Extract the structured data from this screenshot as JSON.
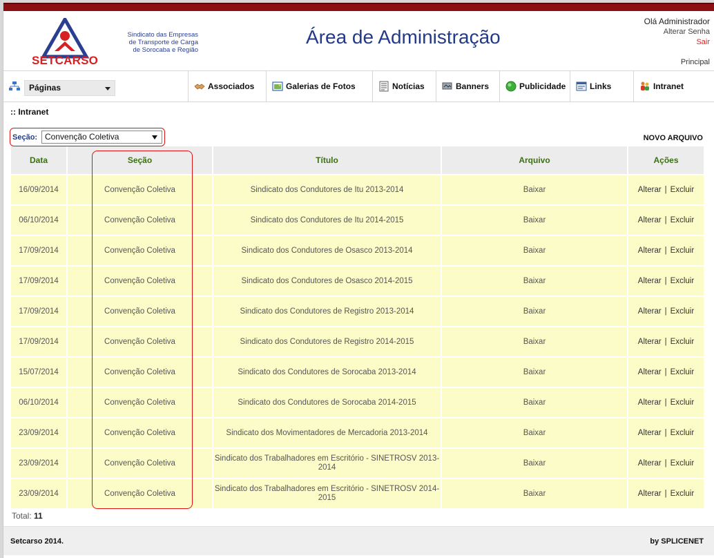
{
  "header": {
    "logo_text_lines": [
      "Sindicato das Empresas",
      "de Transporte de Carga",
      "de Sorocaba e Região"
    ],
    "logo_brand": "SETCARSO",
    "page_title": "Área de Administração",
    "greeting": "Olá Administrador",
    "change_password": "Alterar Senha",
    "logout": "Sair",
    "principal": "Principal"
  },
  "nav": {
    "pages_label": "Páginas",
    "items": [
      {
        "label": "Associados",
        "icon": "handshake-icon"
      },
      {
        "label": "Galerias de Fotos",
        "icon": "photo-gallery-icon"
      },
      {
        "label": "Notícias",
        "icon": "news-icon"
      },
      {
        "label": "Banners",
        "icon": "banner-icon"
      },
      {
        "label": "Publicidade",
        "icon": "green-circle-icon"
      },
      {
        "label": "Links",
        "icon": "links-icon"
      },
      {
        "label": "Intranet",
        "icon": "users-icon"
      }
    ]
  },
  "breadcrumb": ":: Intranet",
  "filter": {
    "label": "Seção:",
    "value": "Convenção Coletiva"
  },
  "new_file": "NOVO ARQUIVO",
  "table": {
    "headers": [
      "Data",
      "Seção",
      "Título",
      "Arquivo",
      "Ações"
    ],
    "rows": [
      {
        "date": "16/09/2014",
        "section": "Convenção Coletiva",
        "title": "Sindicato dos Condutores de Itu 2013-2014",
        "file": "Baixar"
      },
      {
        "date": "06/10/2014",
        "section": "Convenção Coletiva",
        "title": "Sindicato dos Condutores de Itu 2014-2015",
        "file": "Baixar"
      },
      {
        "date": "17/09/2014",
        "section": "Convenção Coletiva",
        "title": "Sindicato dos Condutores de Osasco 2013-2014",
        "file": "Baixar"
      },
      {
        "date": "17/09/2014",
        "section": "Convenção Coletiva",
        "title": "Sindicato dos Condutores de Osasco 2014-2015",
        "file": "Baixar"
      },
      {
        "date": "17/09/2014",
        "section": "Convenção Coletiva",
        "title": "Sindicato dos Condutores de Registro 2013-2014",
        "file": "Baixar"
      },
      {
        "date": "17/09/2014",
        "section": "Convenção Coletiva",
        "title": "Sindicato dos Condutores de Registro 2014-2015",
        "file": "Baixar"
      },
      {
        "date": "15/07/2014",
        "section": "Convenção Coletiva",
        "title": "Sindicato dos Condutores de Sorocaba 2013-2014",
        "file": "Baixar"
      },
      {
        "date": "06/10/2014",
        "section": "Convenção Coletiva",
        "title": "Sindicato dos Condutores de Sorocaba 2014-2015",
        "file": "Baixar"
      },
      {
        "date": "23/09/2014",
        "section": "Convenção Coletiva",
        "title": "Sindicato dos Movimentadores de Mercadoria 2013-2014",
        "file": "Baixar"
      },
      {
        "date": "23/09/2014",
        "section": "Convenção Coletiva",
        "title": "Sindicato dos Trabalhadores em Escritório - SINETROSV 2013-2014",
        "file": "Baixar"
      },
      {
        "date": "23/09/2014",
        "section": "Convenção Coletiva",
        "title": "Sindicato dos Trabalhadores em Escritório - SINETROSV 2014-2015",
        "file": "Baixar"
      }
    ],
    "action_edit": "Alterar",
    "action_delete": "Excluir",
    "action_separator": "|"
  },
  "total": {
    "label": "Total:",
    "count": "11"
  },
  "footer": {
    "left": "Setcarso 2014.",
    "right": "by SPLICENET"
  },
  "colors": {
    "brand_red": "#8b0f13",
    "title_blue": "#233a8a",
    "row_yellow": "#fcfcc8",
    "header_green": "#3b6f13",
    "highlight_red": "#dd1111"
  }
}
